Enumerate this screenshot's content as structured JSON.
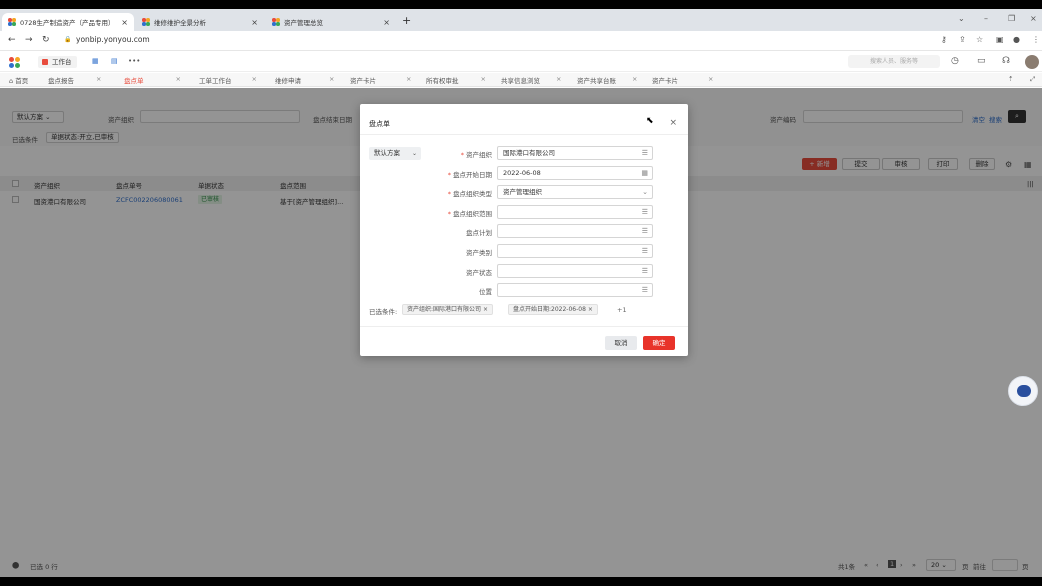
{
  "browser": {
    "tabs": [
      {
        "title": "0728生产制造资产（产品专用）",
        "active": true
      },
      {
        "title": "维修维护全景分析",
        "active": false
      },
      {
        "title": "资产管理总览",
        "active": false
      }
    ],
    "url": "yonbip.yonyou.com"
  },
  "app": {
    "workbench_label": "工作台",
    "search_placeholder": "搜索人员、服务等",
    "tabs": [
      {
        "label": "首页",
        "active": false
      },
      {
        "label": "盘点报告",
        "active": false
      },
      {
        "label": "盘点单",
        "active": true
      },
      {
        "label": "工单工作台",
        "active": false
      },
      {
        "label": "维修申请",
        "active": false
      },
      {
        "label": "资产卡片",
        "active": false
      },
      {
        "label": "所有权审批",
        "active": false
      },
      {
        "label": "共享信息浏览",
        "active": false
      },
      {
        "label": "资产共享台账",
        "active": false
      },
      {
        "label": "资产卡片",
        "active": false
      }
    ]
  },
  "page": {
    "scheme_label": "默认方案",
    "asset_org_label": "资产组织",
    "end_date_label": "盘点结束日期",
    "asset_code_label": "资产编码",
    "links": {
      "reset": "清空",
      "save": "搜索"
    },
    "conditions_label": "已选条件",
    "condition_chip": "单据状态:开立,已审核",
    "toolbar": {
      "new": "+ 新增",
      "submit": "提交",
      "approve": "审核",
      "print": "打印",
      "delete": "删除"
    },
    "columns": [
      "资产组织",
      "盘点单号",
      "单据状态",
      "盘点范围"
    ],
    "rows": [
      {
        "org": "国资港口有限公司",
        "code": "ZCFC002206080061",
        "status": "已审核",
        "scope": "基于[资产管理组织]..."
      }
    ],
    "footer_selected": "已选 0 行",
    "pagination": {
      "total": "共1条",
      "current": "1",
      "page_size": "20",
      "goto": "前往",
      "page_unit": "页"
    }
  },
  "modal": {
    "title": "盘点单",
    "scheme_label": "默认方案",
    "fields": [
      {
        "label": "资产组织",
        "required": true,
        "value": "国际港口有限公司",
        "icon": "list-icon"
      },
      {
        "label": "盘点开始日期",
        "required": true,
        "value": "2022-06-08",
        "icon": "calendar-icon"
      },
      {
        "label": "盘点组织类型",
        "required": true,
        "value": "资产管理组织",
        "icon": "chevron-down-icon"
      },
      {
        "label": "盘点组织范围",
        "required": true,
        "value": "",
        "icon": "list-icon"
      },
      {
        "label": "盘点计划",
        "required": false,
        "value": "",
        "icon": "list-icon"
      },
      {
        "label": "资产类别",
        "required": false,
        "value": "",
        "icon": "list-icon"
      },
      {
        "label": "资产状态",
        "required": false,
        "value": "",
        "icon": "list-icon"
      },
      {
        "label": "位置",
        "required": false,
        "value": "",
        "icon": "list-icon"
      }
    ],
    "conditions_label": "已选条件:",
    "chips": [
      "资产组织:国际港口有限公司",
      "盘点开始日期:2022-06-08"
    ],
    "more": "+1",
    "cancel": "取消",
    "ok": "确定"
  }
}
